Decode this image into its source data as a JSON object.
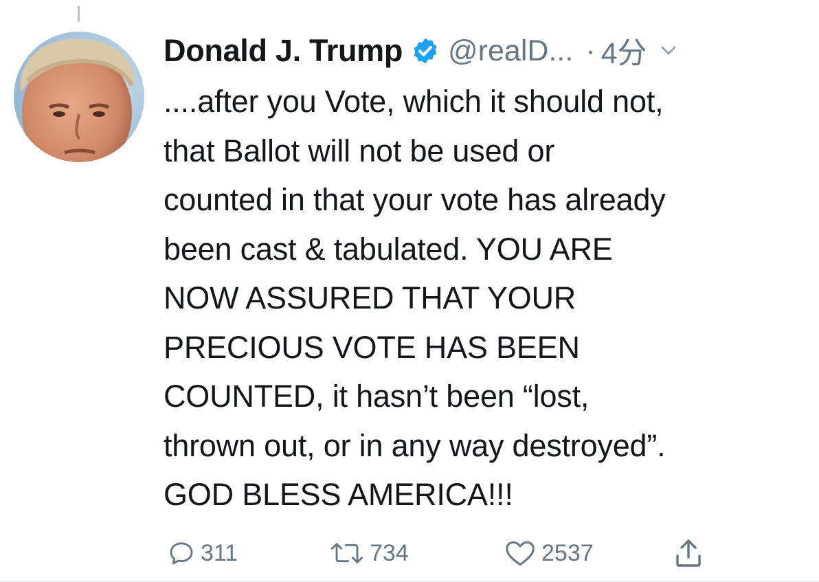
{
  "author": {
    "display_name": "Donald J. Trump",
    "handle": "@realD...",
    "separator": "·",
    "time_ago": "4分",
    "verified": true
  },
  "tweet": {
    "lines": [
      "....after you Vote, which it should not,",
      "that Ballot will not be used or",
      "counted in that your vote has already",
      "been cast & tabulated. YOU ARE",
      "NOW ASSURED THAT YOUR",
      "PRECIOUS VOTE HAS BEEN",
      "COUNTED, it hasn’t been “lost,",
      "thrown out, or in any way destroyed”.",
      "GOD BLESS AMERICA!!!"
    ]
  },
  "actions": {
    "replies": "311",
    "retweets": "734",
    "likes": "2537"
  },
  "icons": {
    "verified": "verified-badge-icon",
    "caret": "chevron-down-icon",
    "reply": "reply-icon",
    "retweet": "retweet-icon",
    "like": "heart-icon",
    "share": "share-icon"
  },
  "colors": {
    "text": "#14171a",
    "secondary": "#657786",
    "verified": "#1da1f2"
  }
}
